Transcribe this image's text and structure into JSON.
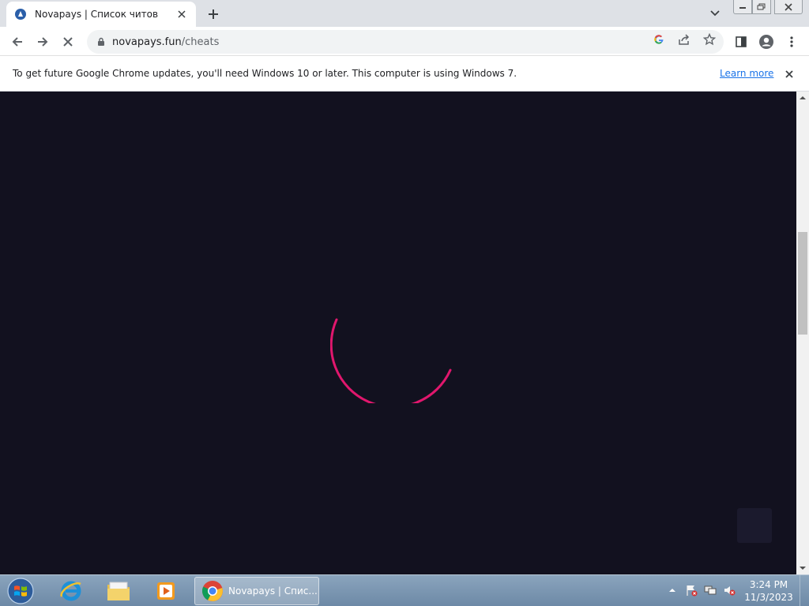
{
  "browser": {
    "tab": {
      "title": "Novapays | Список читов",
      "favicon": "novapays-logo-icon"
    },
    "address": {
      "host": "novapays.fun",
      "path": "/cheats"
    }
  },
  "infobar": {
    "message": "To get future Google Chrome updates, you'll need Windows 10 or later. This computer is using Windows 7.",
    "link": "Learn more"
  },
  "page": {
    "state": "loading",
    "spinner_color": "#e0176d",
    "background": "#12111f"
  },
  "taskbar": {
    "active_window": "Novapays | Спис...",
    "clock": {
      "time": "3:24 PM",
      "date": "11/3/2023"
    }
  }
}
